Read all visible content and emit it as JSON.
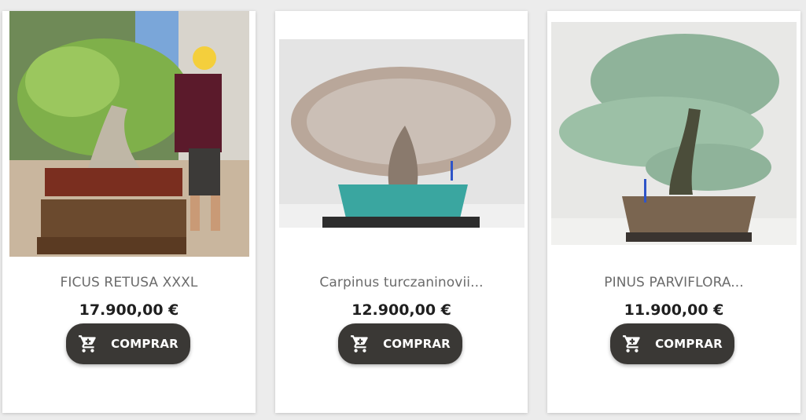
{
  "products": [
    {
      "name": "FICUS RETUSA XXXL",
      "price": "17.900,00 €",
      "button_label": "COMPRAR",
      "button_icon": "shopping-cart-icon"
    },
    {
      "name": "Carpinus turczaninovii...",
      "price": "12.900,00 €",
      "button_label": "COMPRAR",
      "button_icon": "shopping-cart-icon"
    },
    {
      "name": "PINUS PARVIFLORA...",
      "price": "11.900,00 €",
      "button_label": "COMPRAR",
      "button_icon": "shopping-cart-icon"
    }
  ],
  "colors": {
    "button_bg": "#3a3835",
    "price_text": "#1f1f1f",
    "name_text": "#6b6b6b"
  }
}
